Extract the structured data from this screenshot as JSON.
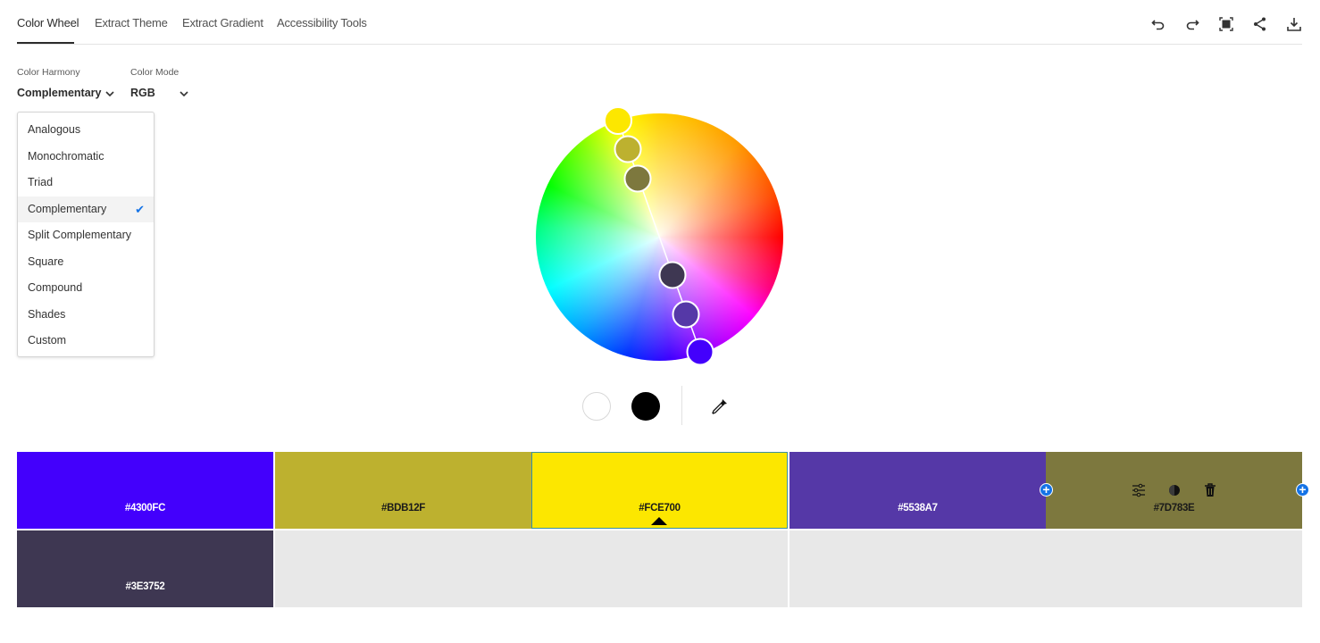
{
  "tabs": [
    {
      "label": "Color Wheel",
      "active": true
    },
    {
      "label": "Extract Theme",
      "active": false
    },
    {
      "label": "Extract Gradient",
      "active": false
    },
    {
      "label": "Accessibility Tools",
      "active": false
    }
  ],
  "toolbar": [
    {
      "icon": "undo-icon"
    },
    {
      "icon": "redo-icon"
    },
    {
      "icon": "fullscreen-icon"
    },
    {
      "icon": "share-icon"
    },
    {
      "icon": "download-icon"
    }
  ],
  "harmony": {
    "label": "Color Harmony",
    "value": "Complementary",
    "options": [
      "Analogous",
      "Monochromatic",
      "Triad",
      "Complementary",
      "Split Complementary",
      "Square",
      "Compound",
      "Shades",
      "Custom"
    ],
    "selected_index": 3
  },
  "mode": {
    "label": "Color Mode",
    "value": "RGB"
  },
  "wheel": {
    "handles": [
      {
        "color": "#FCE700",
        "base": true
      },
      {
        "color": "#BDB12F"
      },
      {
        "color": "#7D783E"
      },
      {
        "color": "#3E3752"
      },
      {
        "color": "#5538A7"
      },
      {
        "color": "#4300FC"
      }
    ]
  },
  "wheel_tools": {
    "white_label": "white",
    "black_label": "black"
  },
  "swatches": [
    {
      "hex": "#4300FC",
      "color": "#4300FC",
      "text_color": "#ffffff"
    },
    {
      "hex": "#BDB12F",
      "color": "#BDB12F",
      "text_color": "#1a1a1a"
    },
    {
      "hex": "#FCE700",
      "color": "#FCE700",
      "text_color": "#1a1a1a",
      "selected": true
    },
    {
      "hex": "#5538A7",
      "color": "#5538A7",
      "text_color": "#ffffff"
    },
    {
      "hex": "#7D783E",
      "color": "#7D783E",
      "text_color": "#1a1a1a",
      "hovered": true
    },
    {
      "hex": "#3E3752",
      "color": "#3E3752",
      "text_color": "#ffffff"
    }
  ]
}
